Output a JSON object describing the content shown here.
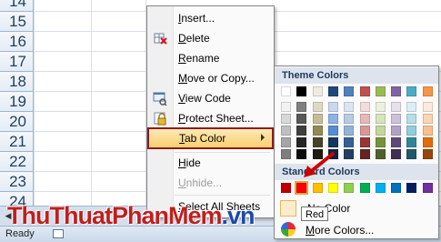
{
  "rows": [
    "14",
    "15",
    "16",
    "17",
    "18",
    "19",
    "20",
    "21",
    "22",
    "23",
    "24"
  ],
  "context_menu": {
    "items": [
      {
        "label": "Insert...",
        "underline": "I",
        "rest": "nsert...",
        "disabled": false
      },
      {
        "label": "Delete",
        "underline": "D",
        "rest": "elete",
        "disabled": false
      },
      {
        "label": "Rename",
        "underline": "R",
        "rest": "ename",
        "disabled": false
      },
      {
        "label": "Move or Copy...",
        "underline": "M",
        "rest": "ove or Copy...",
        "disabled": false
      },
      {
        "label": "View Code",
        "underline": "V",
        "rest": "iew Code",
        "disabled": false
      },
      {
        "label": "Protect Sheet...",
        "underline": "P",
        "rest": "rotect Sheet...",
        "disabled": false
      },
      {
        "label": "Tab Color",
        "underline": "T",
        "rest": "ab Color",
        "disabled": false,
        "highlighted": true
      },
      {
        "label": "Hide",
        "underline": "H",
        "rest": "ide",
        "disabled": false
      },
      {
        "label": "Unhide...",
        "underline": "U",
        "rest": "nhide...",
        "disabled": true
      },
      {
        "label": "Select All Sheets",
        "underline": "S",
        "rest": "elect All Sheets",
        "disabled": false
      }
    ]
  },
  "palette": {
    "theme_header": "Theme Colors",
    "standard_header": "Standard Colors",
    "theme_top": [
      "#ffffff",
      "#000000",
      "#eeece1",
      "#1f497d",
      "#4f81bd",
      "#c0504d",
      "#9bbb59",
      "#8064a2",
      "#4bacc6",
      "#f79646"
    ],
    "theme_shades": [
      [
        "#f2f2f2",
        "#7f7f7f",
        "#ddd9c3",
        "#c6d9f0",
        "#dbe5f1",
        "#f2dcdb",
        "#ebf1dd",
        "#e5e0ec",
        "#dbeef3",
        "#fdeada"
      ],
      [
        "#d8d8d8",
        "#595959",
        "#c4bd97",
        "#8db3e2",
        "#b8cce4",
        "#e5b9b7",
        "#d7e3bc",
        "#ccc1d9",
        "#b7dde8",
        "#fbd5b5"
      ],
      [
        "#bfbfbf",
        "#3f3f3f",
        "#938953",
        "#548dd4",
        "#95b3d7",
        "#d99694",
        "#c3d69b",
        "#b2a2c7",
        "#92cddc",
        "#fac08f"
      ],
      [
        "#a5a5a5",
        "#262626",
        "#494429",
        "#17365d",
        "#366092",
        "#953734",
        "#76923c",
        "#5f497a",
        "#31859b",
        "#e36c09"
      ],
      [
        "#7f7f7f",
        "#0c0c0c",
        "#1d1b10",
        "#0f243e",
        "#244061",
        "#632423",
        "#4f6128",
        "#3f3151",
        "#205867",
        "#974806"
      ]
    ],
    "standard": [
      "#c00000",
      "#ff0000",
      "#ffc000",
      "#ffff00",
      "#92d050",
      "#00b050",
      "#00b0f0",
      "#0070c0",
      "#002060",
      "#7030a0"
    ],
    "selected_standard_index": 1,
    "no_color_label": "No Color",
    "more_colors_label": "More Colors...",
    "more_colors_underline": "M",
    "more_colors_rest": "ore Colors..."
  },
  "tooltip": "Red",
  "status": {
    "ready": "Ready"
  },
  "watermark": {
    "main": "ThuThuatPhanMem",
    "suffix": ".vn"
  },
  "colors": {
    "highlight_border": "#8b1c1c",
    "arrow": "#cc0000"
  }
}
